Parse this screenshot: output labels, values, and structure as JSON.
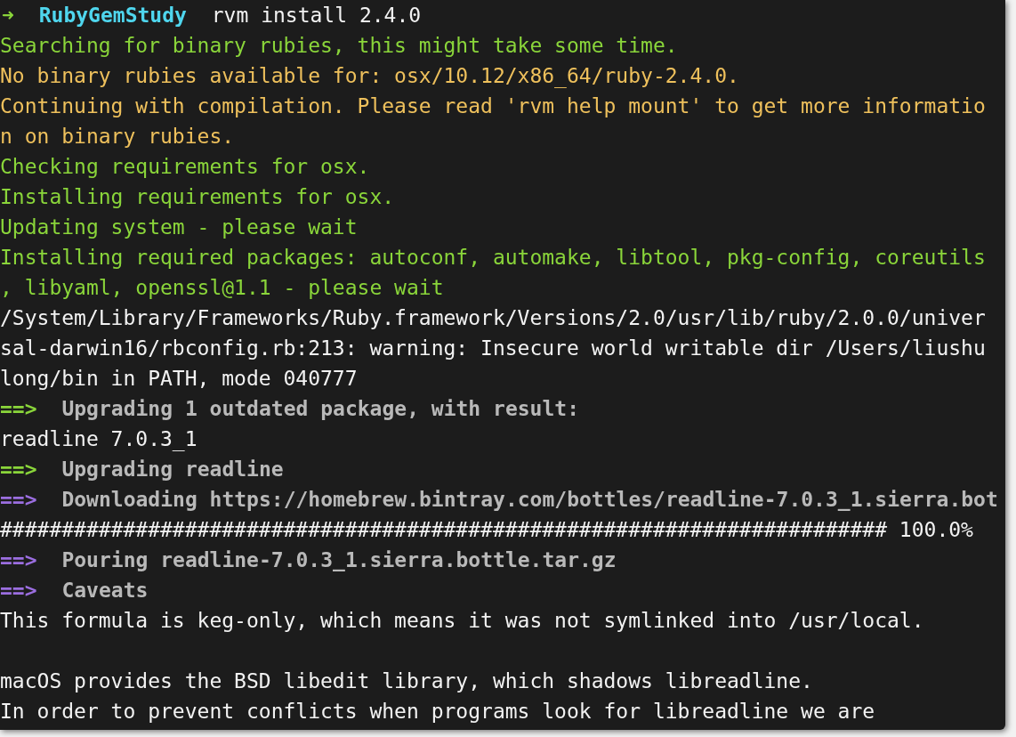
{
  "terminal": {
    "lines": [
      {
        "kind": "prompt",
        "arrow": "➜",
        "directory": "RubyGemStudy",
        "command": "rvm install 2.4.0"
      },
      {
        "kind": "info",
        "text": "Searching for binary rubies, this might take some time."
      },
      {
        "kind": "warn",
        "text": "No binary rubies available for: osx/10.12/x86_64/ruby-2.4.0."
      },
      {
        "kind": "warn",
        "text": "Continuing with compilation. Please read 'rvm help mount' to get more informatio"
      },
      {
        "kind": "warn",
        "text": "n on binary rubies."
      },
      {
        "kind": "info",
        "text": "Checking requirements for osx."
      },
      {
        "kind": "info",
        "text": "Installing requirements for osx."
      },
      {
        "kind": "info",
        "text": "Updating system - please wait"
      },
      {
        "kind": "info",
        "text": "Installing required packages: autoconf, automake, libtool, pkg-config, coreutils"
      },
      {
        "kind": "info",
        "text": ", libyaml, openssl@1.1 - please wait"
      },
      {
        "kind": "plain",
        "text": "/System/Library/Frameworks/Ruby.framework/Versions/2.0/usr/lib/ruby/2.0.0/univer"
      },
      {
        "kind": "plain",
        "text": "sal-darwin16/rbconfig.rb:213: warning: Insecure world writable dir /Users/liushu"
      },
      {
        "kind": "plain",
        "text": "long/bin in PATH, mode 040777"
      },
      {
        "kind": "step",
        "marker": "==>",
        "color": "#8ad53a",
        "text": "Upgrading 1 outdated package, with result:"
      },
      {
        "kind": "plain",
        "text": "readline 7.0.3_1"
      },
      {
        "kind": "step",
        "marker": "==>",
        "color": "#8ad53a",
        "text": "Upgrading readline"
      },
      {
        "kind": "step",
        "marker": "==>",
        "color": "#9b6ee0",
        "text": "Downloading https://homebrew.bintray.com/bottles/readline-7.0.3_1.sierra.bot"
      },
      {
        "kind": "plain",
        "text": "######################################################################## 100.0%"
      },
      {
        "kind": "step",
        "marker": "==>",
        "color": "#9b6ee0",
        "text": "Pouring readline-7.0.3_1.sierra.bottle.tar.gz"
      },
      {
        "kind": "step",
        "marker": "==>",
        "color": "#9b6ee0",
        "text": "Caveats"
      },
      {
        "kind": "plain",
        "text": "This formula is keg-only, which means it was not symlinked into /usr/local."
      },
      {
        "kind": "blank"
      },
      {
        "kind": "plain",
        "text": "macOS provides the BSD libedit library, which shadows libreadline."
      },
      {
        "kind": "plain",
        "text": "In order to prevent conflicts when programs look for libreadline we are"
      }
    ]
  }
}
